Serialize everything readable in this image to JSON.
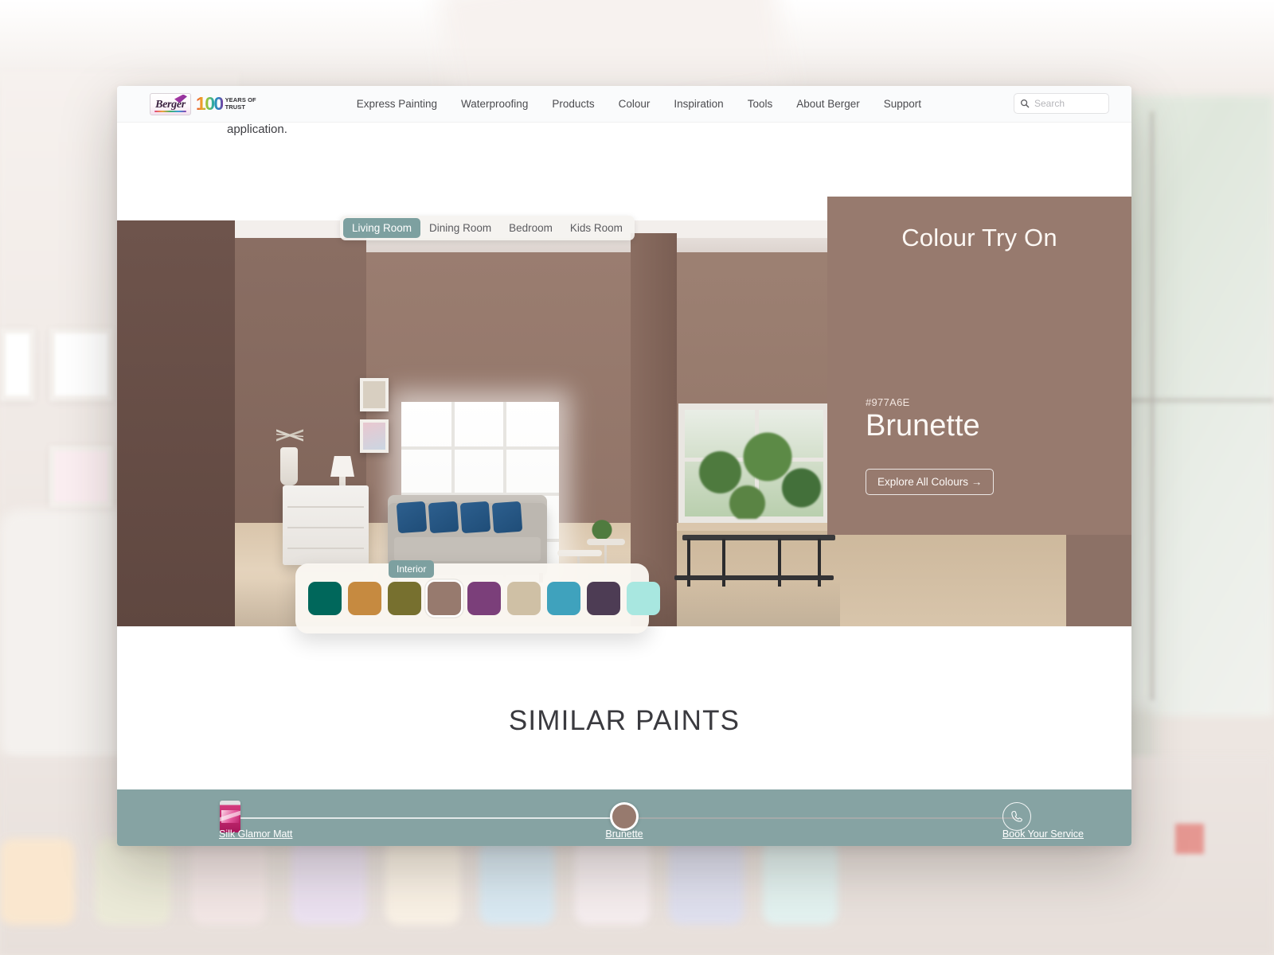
{
  "header": {
    "logo": {
      "brand": "Berger",
      "hundred": "100",
      "years_line1": "YEARS OF",
      "years_line2": "TRUST",
      "logo_icon": "berger-paints-logo"
    },
    "nav": [
      {
        "label": "Express Painting"
      },
      {
        "label": "Waterproofing"
      },
      {
        "label": "Products"
      },
      {
        "label": "Colour"
      },
      {
        "label": "Inspiration"
      },
      {
        "label": "Tools"
      },
      {
        "label": "About Berger"
      },
      {
        "label": "Support"
      }
    ],
    "search": {
      "placeholder": "Search",
      "value": "",
      "icon": "search-icon"
    }
  },
  "content": {
    "scrolled_text": "application."
  },
  "room_tabs": {
    "items": [
      {
        "label": "Living Room",
        "active": true
      },
      {
        "label": "Dining Room",
        "active": false
      },
      {
        "label": "Bedroom",
        "active": false
      },
      {
        "label": "Kids Room",
        "active": false
      }
    ],
    "active_color": "#7da0a0"
  },
  "palette": {
    "badge": "Interior",
    "swatches": [
      {
        "hex": "#00675B",
        "selected": false
      },
      {
        "hex": "#C68A40",
        "selected": false
      },
      {
        "hex": "#77702F",
        "selected": false
      },
      {
        "hex": "#977A6E",
        "selected": true
      },
      {
        "hex": "#7B3F7A",
        "selected": false
      },
      {
        "hex": "#CFC0A5",
        "selected": false
      },
      {
        "hex": "#3FA2BD",
        "selected": false
      },
      {
        "hex": "#4D3C54",
        "selected": false
      },
      {
        "hex": "#A8E7E0",
        "selected": false
      }
    ]
  },
  "colour_panel": {
    "title": "Colour Try On",
    "hex": "#977A6E",
    "name": "Brunette",
    "cta": "Explore All Colours →",
    "panel_color": "#977A6E"
  },
  "similar": {
    "title": "SIMILAR PAINTS"
  },
  "bottom_bar": {
    "background": "#86a3a3",
    "product_label": "Silk Glamor Matt",
    "colour_label": "Brunette",
    "service_label": "Book Your Service",
    "paint_can_icon": "paint-can-icon",
    "phone_icon": "phone-icon",
    "handle_color": "#977A6E"
  }
}
